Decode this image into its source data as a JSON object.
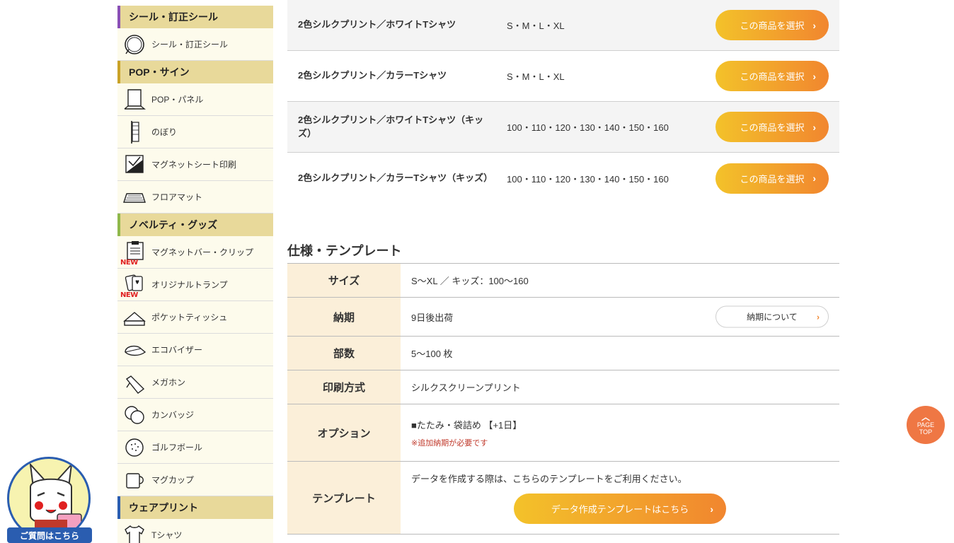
{
  "sidebar": {
    "sections": [
      {
        "title": "シール・訂正シール",
        "items": [
          {
            "label": "シール・訂正シール",
            "icon": "sticker-roll-icon",
            "new": false
          }
        ]
      },
      {
        "title": "POP・サイン",
        "items": [
          {
            "label": "POP・パネル",
            "icon": "pop-panel-icon",
            "new": false
          },
          {
            "label": "のぼり",
            "icon": "banner-flag-icon",
            "new": false
          },
          {
            "label": "マグネットシート印刷",
            "icon": "magnet-sheet-icon",
            "new": false
          },
          {
            "label": "フロアマット",
            "icon": "floor-mat-icon",
            "new": false
          }
        ]
      },
      {
        "title": "ノベルティ・グッズ",
        "items": [
          {
            "label": "マグネットバー・クリップ",
            "icon": "magnet-clip-icon",
            "new": true
          },
          {
            "label": "オリジナルトランプ",
            "icon": "playing-cards-icon",
            "new": true
          },
          {
            "label": "ポケットティッシュ",
            "icon": "pocket-tissue-icon",
            "new": false
          },
          {
            "label": "エコバイザー",
            "icon": "visor-icon",
            "new": false
          },
          {
            "label": "メガホン",
            "icon": "megaphone-icon",
            "new": false
          },
          {
            "label": "カンバッジ",
            "icon": "can-badge-icon",
            "new": false
          },
          {
            "label": "ゴルフボール",
            "icon": "golf-ball-icon",
            "new": false
          },
          {
            "label": "マグカップ",
            "icon": "mug-icon",
            "new": false
          }
        ]
      },
      {
        "title": "ウェアプリント",
        "items": [
          {
            "label": "Tシャツ",
            "icon": "tshirt-icon",
            "new": false
          }
        ]
      }
    ],
    "new_badge": "NEW"
  },
  "products": [
    {
      "name": "2色シルクプリント／ホワイトTシャツ",
      "sizes": "S・M・L・XL",
      "button": "この商品を選択"
    },
    {
      "name": "2色シルクプリント／カラーTシャツ",
      "sizes": "S・M・L・XL",
      "button": "この商品を選択"
    },
    {
      "name": "2色シルクプリント／ホワイトTシャツ（キッズ）",
      "sizes": "100・110・120・130・140・150・160",
      "button": "この商品を選択"
    },
    {
      "name": "2色シルクプリント／カラーTシャツ（キッズ）",
      "sizes": "100・110・120・130・140・150・160",
      "button": "この商品を選択"
    }
  ],
  "spec": {
    "title": "仕様・テンプレート",
    "rows": {
      "size": {
        "key": "サイズ",
        "value": "S〜XL ／ キッズ：100〜160"
      },
      "delivery": {
        "key": "納期",
        "value": "9日後出荷",
        "button": "納期について"
      },
      "quantity": {
        "key": "部数",
        "value": "5〜100 枚"
      },
      "print": {
        "key": "印刷方式",
        "value": "シルクスクリーンプリント"
      },
      "option": {
        "key": "オプション",
        "value": "■たたみ・袋詰め 【+1日】",
        "note": "※追加納期が必要です"
      },
      "template": {
        "key": "テンプレート",
        "value": "データを作成する際は、こちらのテンプレートをご利用ください。",
        "button": "データ作成テンプレートはこちら"
      }
    }
  },
  "page_top": {
    "line1": "PAGE",
    "line2": "TOP"
  },
  "help": {
    "label": "ご質問はこちら"
  },
  "colors": {
    "accent_start": "#f3c22a",
    "accent_end": "#f1862f",
    "sidebar_head": "#e8d99a",
    "spec_key_bg": "#fbefd9",
    "page_top": "#ef7744",
    "help_blue": "#2a5db0"
  }
}
